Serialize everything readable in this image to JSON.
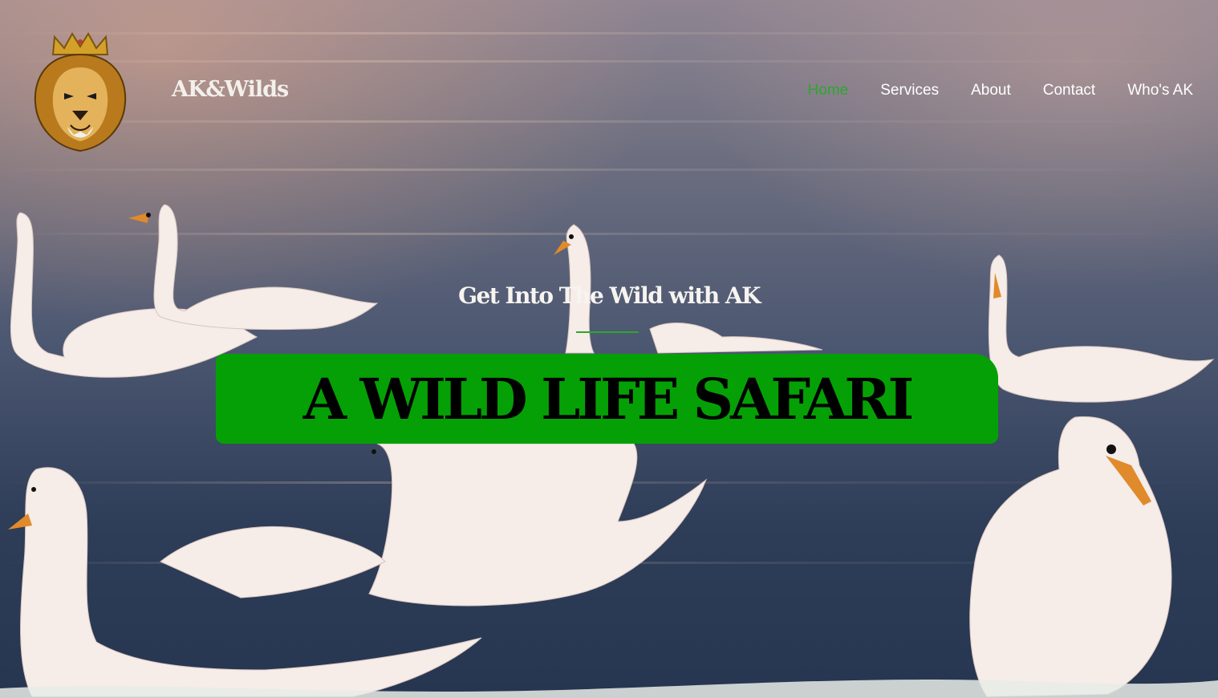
{
  "brand": {
    "name": "AK&Wilds",
    "logo": "crowned-lion-logo"
  },
  "nav": {
    "items": [
      {
        "label": "Home",
        "active": true
      },
      {
        "label": "Services",
        "active": false
      },
      {
        "label": "About",
        "active": false
      },
      {
        "label": "Contact",
        "active": false
      },
      {
        "label": "Who's AK",
        "active": false
      }
    ]
  },
  "hero": {
    "subtitle": "Get Into The Wild with AK",
    "title": "A WILD LIFE SAFARI",
    "background": "swans-on-lake-photo"
  },
  "colors": {
    "accent": "#2ea62e",
    "banner": "#05a005",
    "text_light": "#ffffff"
  }
}
